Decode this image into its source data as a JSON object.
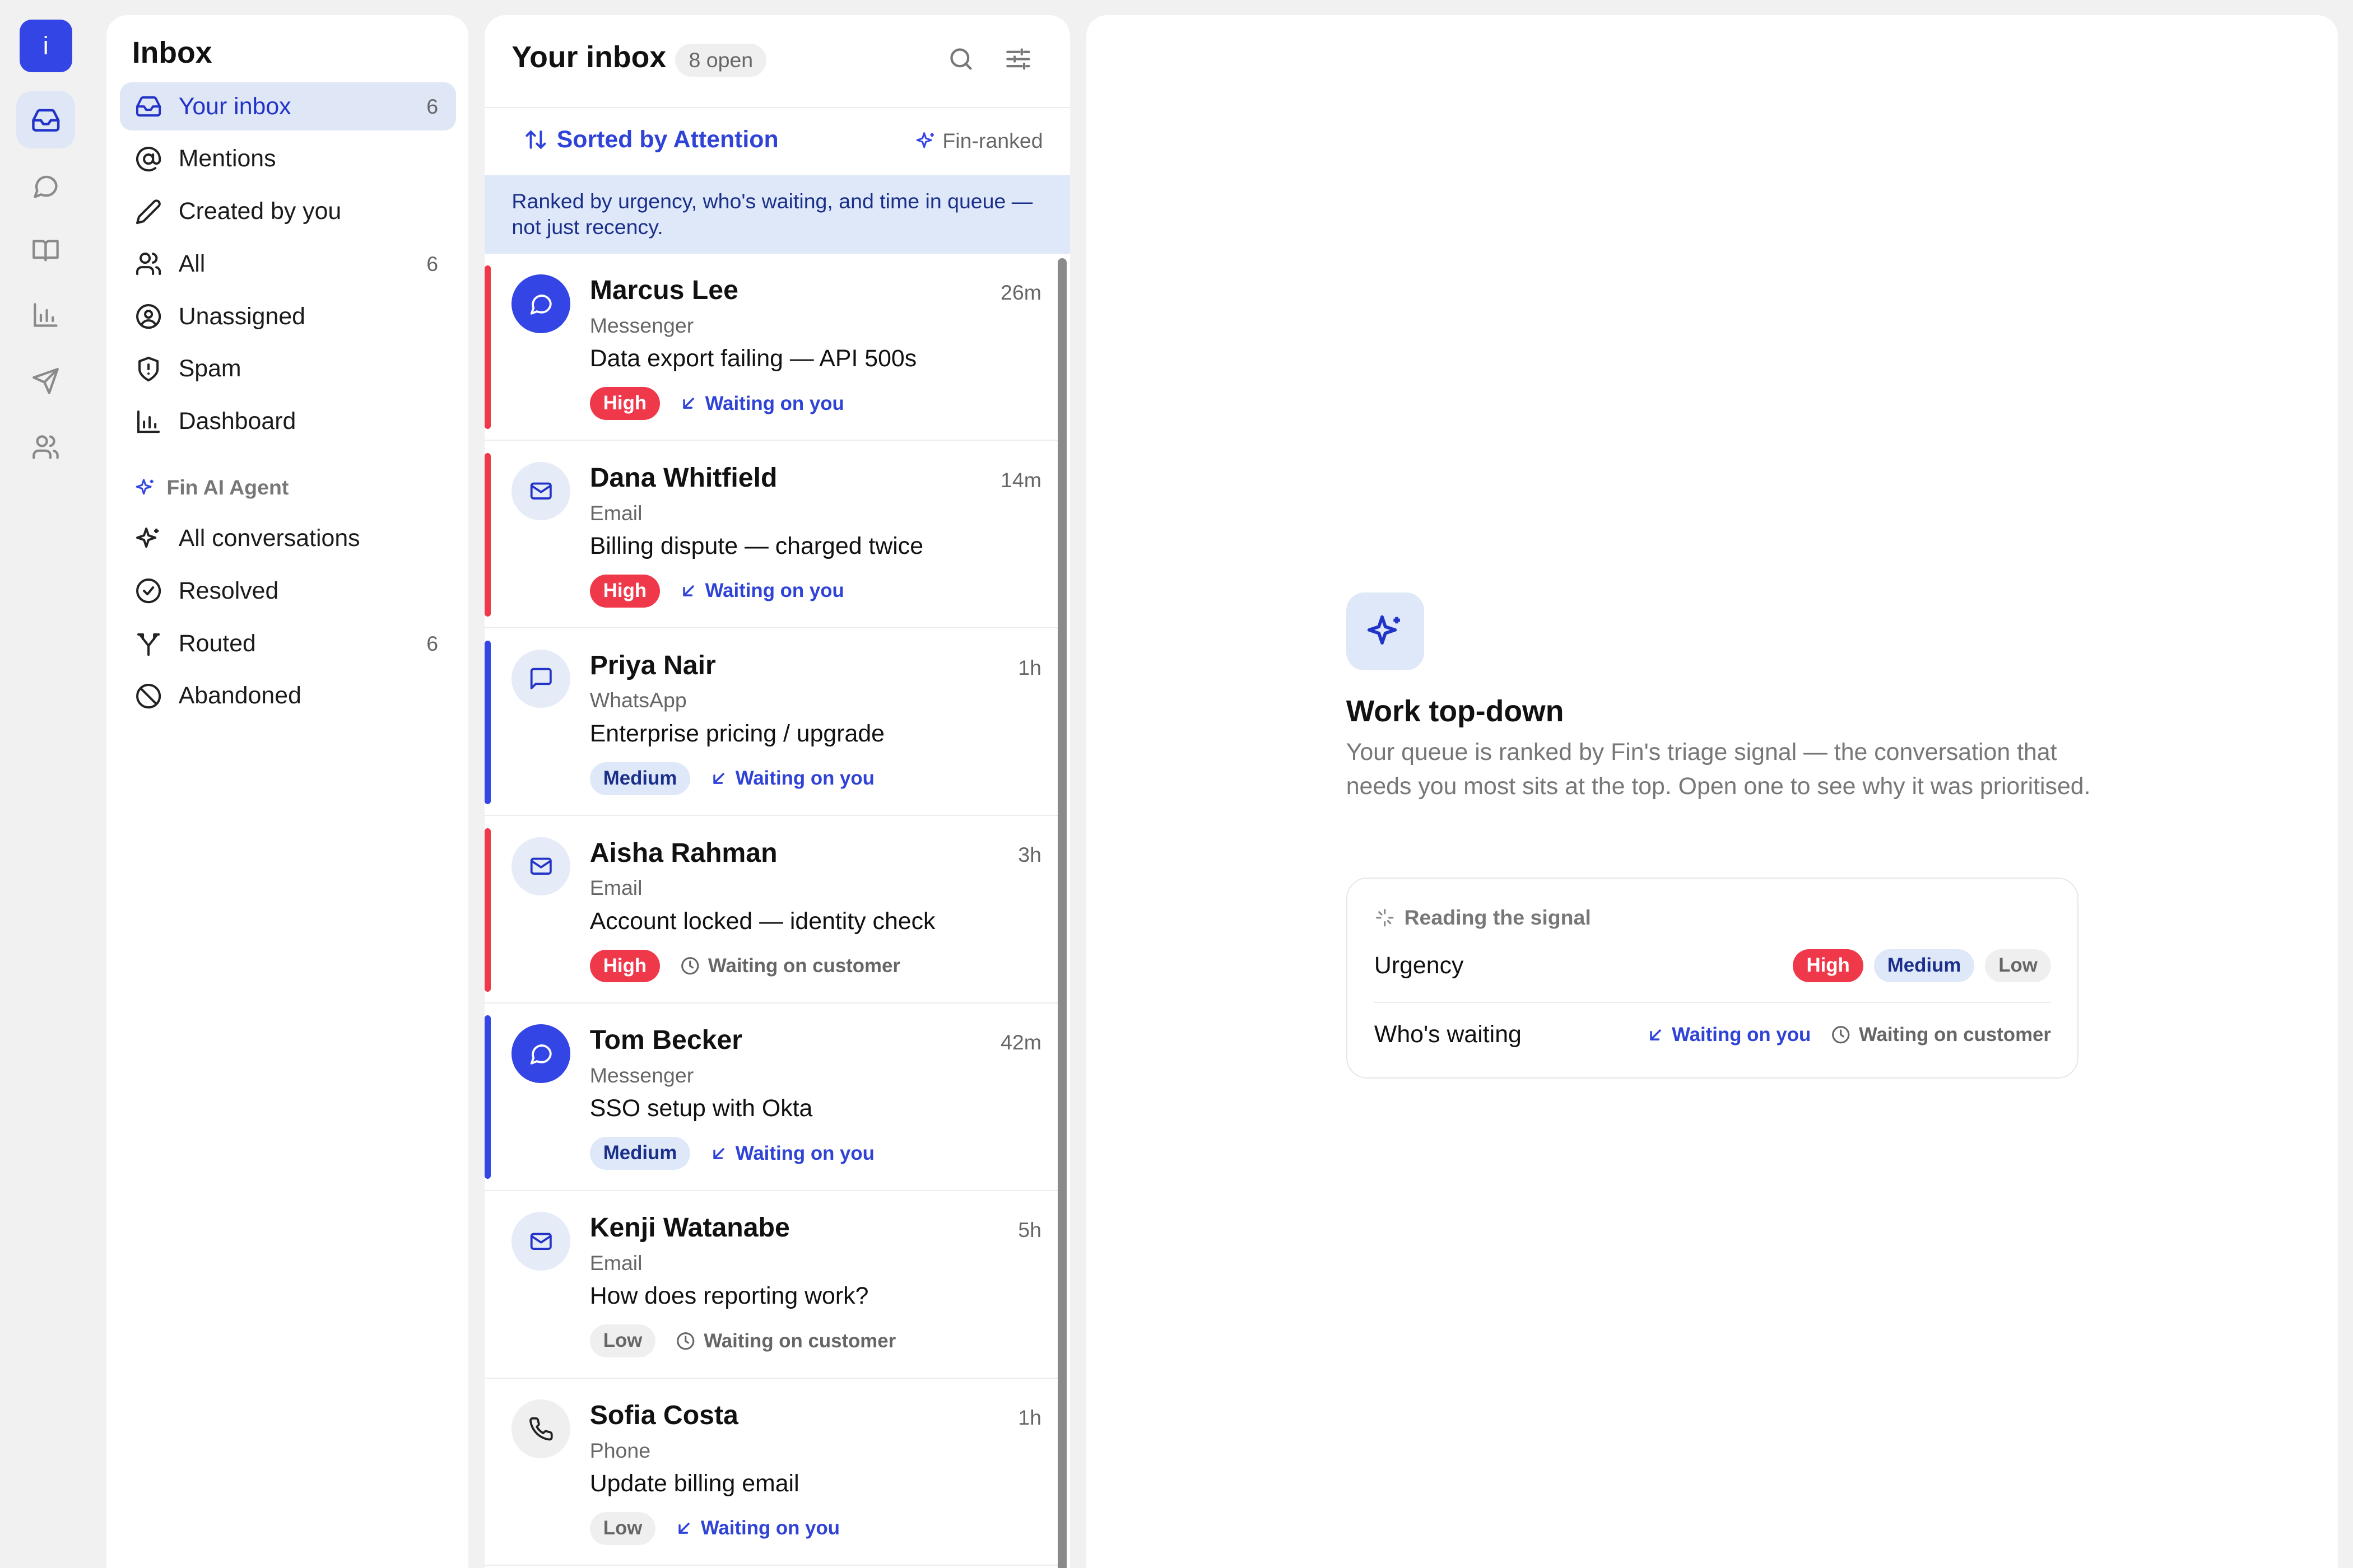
{
  "rail": {
    "logo": "i",
    "icons": [
      "inbox-icon",
      "chat-icon",
      "book-icon",
      "chart-icon",
      "send-icon",
      "users-icon"
    ]
  },
  "nav": {
    "title": "Inbox",
    "items": [
      {
        "label": "Your inbox",
        "count": "6",
        "icon": "inbox-icon",
        "active": true
      },
      {
        "label": "Mentions",
        "count": "",
        "icon": "at-icon"
      },
      {
        "label": "Created by you",
        "count": "",
        "icon": "pencil-icon"
      },
      {
        "label": "All",
        "count": "6",
        "icon": "users-icon"
      },
      {
        "label": "Unassigned",
        "count": "",
        "icon": "user-circle-icon"
      },
      {
        "label": "Spam",
        "count": "",
        "icon": "shield-icon"
      },
      {
        "label": "Dashboard",
        "count": "",
        "icon": "chart-icon"
      }
    ],
    "section": "Fin AI Agent",
    "fin_items": [
      {
        "label": "All conversations",
        "count": "",
        "icon": "sparkles-icon"
      },
      {
        "label": "Resolved",
        "count": "",
        "icon": "check-circle-icon"
      },
      {
        "label": "Routed",
        "count": "6",
        "icon": "route-icon"
      },
      {
        "label": "Abandoned",
        "count": "",
        "icon": "ban-icon"
      }
    ]
  },
  "list": {
    "title": "Your inbox",
    "open_badge": "8 open",
    "sort_label": "Sorted by Attention",
    "fin_ranked": "Fin-ranked",
    "banner": "Ranked by urgency, who's waiting, and time in queue — not just recency.",
    "rows": [
      {
        "name": "Marcus Lee",
        "time": "26m",
        "channel": "Messenger",
        "subject": "Data export failing — API 500s",
        "priority": "High",
        "waiting": "Waiting on you"
      },
      {
        "name": "Dana Whitfield",
        "time": "14m",
        "channel": "Email",
        "subject": "Billing dispute — charged twice",
        "priority": "High",
        "waiting": "Waiting on you"
      },
      {
        "name": "Priya Nair",
        "time": "1h",
        "channel": "WhatsApp",
        "subject": "Enterprise pricing / upgrade",
        "priority": "Medium",
        "waiting": "Waiting on you"
      },
      {
        "name": "Aisha Rahman",
        "time": "3h",
        "channel": "Email",
        "subject": "Account locked — identity check",
        "priority": "High",
        "waiting": "Waiting on customer"
      },
      {
        "name": "Tom Becker",
        "time": "42m",
        "channel": "Messenger",
        "subject": "SSO setup with Okta",
        "priority": "Medium",
        "waiting": "Waiting on you"
      },
      {
        "name": "Kenji Watanabe",
        "time": "5h",
        "channel": "Email",
        "subject": "How does reporting work?",
        "priority": "Low",
        "waiting": "Waiting on customer"
      },
      {
        "name": "Sofia Costa",
        "time": "1h",
        "channel": "Phone",
        "subject": "Update billing email",
        "priority": "Low",
        "waiting": "Waiting on you"
      }
    ]
  },
  "detail": {
    "title": "Work top-down",
    "text": "Your queue is ranked by Fin's triage signal — the conversation that needs you most sits at the top. Open one to see why it was prioritised.",
    "card_head": "Reading the signal",
    "urgency_label": "Urgency",
    "urgency_chips": [
      "High",
      "Medium",
      "Low"
    ],
    "waiting_label": "Who's waiting",
    "waiting_you": "Waiting on you",
    "waiting_customer": "Waiting on customer"
  },
  "colors": {
    "accent": "#3445e5",
    "high": "#f0384b",
    "medium_bg": "#dfe8f8",
    "low_bg": "#efefef"
  }
}
